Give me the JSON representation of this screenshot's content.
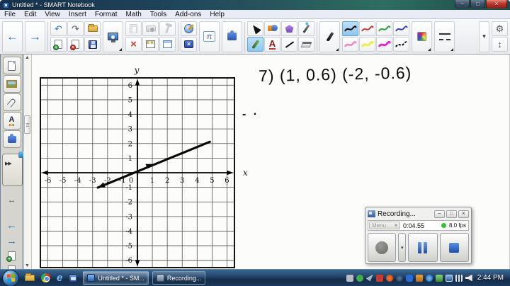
{
  "titlebar": {
    "title": "Untitled * - SMART Notebook"
  },
  "menubar": {
    "items": [
      "File",
      "Edit",
      "View",
      "Insert",
      "Format",
      "Math",
      "Tools",
      "Add-ons",
      "Help"
    ]
  },
  "icons": {
    "back": "←",
    "forward": "→",
    "undo": "↶",
    "redo": "↷",
    "dropdown": "▾",
    "gear": "⚙",
    "updown": "↕",
    "pi": "π",
    "text_tool": "A",
    "toolbox_cross": "×",
    "plus": "+",
    "cross": "×",
    "minimize": "–",
    "maximize": "□",
    "close": "×",
    "handle_play": "▶▶",
    "resize_horizontal": "↔",
    "scroll_up": "▲",
    "scroll_down": "▼",
    "ie_logo": "e"
  },
  "canvas": {
    "handwriting_line": "7)  (1, 0.6)  (-2, -0.6)",
    "handwriting_fragment": "- ·"
  },
  "chart_data": {
    "type": "line",
    "title": "",
    "xlabel": "x",
    "ylabel": "y",
    "xlim": [
      -6.5,
      6.5
    ],
    "ylim": [
      -6.5,
      6.5
    ],
    "x_ticks": [
      -6,
      -5,
      -4,
      -3,
      -2,
      -1,
      0,
      1,
      2,
      3,
      4,
      5,
      6
    ],
    "y_ticks": [
      -6,
      -5,
      -4,
      -3,
      -2,
      -1,
      1,
      2,
      3,
      4,
      5,
      6
    ],
    "grid": true,
    "series": [
      {
        "name": "graphed-line",
        "x": [
          -2.65,
          4.85
        ],
        "y": [
          -1.02,
          2.12
        ],
        "arrow_at_start": true,
        "mid_arrow_point": [
          1,
          0.6
        ]
      }
    ],
    "notable_points": [
      [
        1,
        0.6
      ],
      [
        -2,
        -0.6
      ]
    ],
    "slope": 0.4
  },
  "recording": {
    "title": "Recording...",
    "menu": "Menu",
    "time": "0:04.55",
    "fps": "8.0 fps"
  },
  "taskbar": {
    "tasks": [
      {
        "label": "Untitled * - SM..."
      },
      {
        "label": "Recording..."
      }
    ],
    "clock": "2:44 PM"
  },
  "colors": {
    "pens": [
      "#000000",
      "#c03a30",
      "#2f9e38",
      "#3640b4",
      "#ef86c0",
      "#f2ee55",
      "#de2cc8",
      "#000000"
    ],
    "pen_selected_bg": "#a6d2f2",
    "record_green": "#2fc52f"
  }
}
